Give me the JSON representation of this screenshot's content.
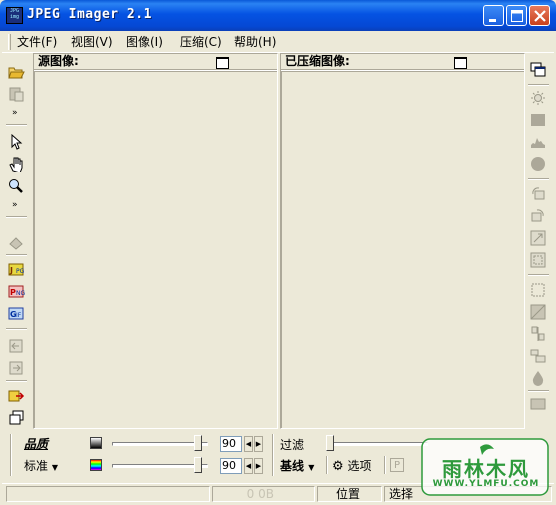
{
  "window": {
    "title": "JPEG Imager 2.1",
    "icon_text": "JPG img"
  },
  "menu": [
    {
      "label": "文件(F)"
    },
    {
      "label": "视图(V)"
    },
    {
      "label": "图像(I)"
    },
    {
      "label": "压缩(C)"
    },
    {
      "label": "帮助(H)"
    }
  ],
  "panels": {
    "source": {
      "title": "源图像:"
    },
    "compressed": {
      "title": "已压缩图像:"
    }
  },
  "controls": {
    "quality_label": "品质",
    "standard_label": "标准",
    "quality_value": "90",
    "chroma_value": "90",
    "filter_label": "过滤",
    "baseline_label": "基线",
    "options_label": "选项",
    "quality_slider_level": 0.9,
    "chroma_slider_level": 0.9
  },
  "status": {
    "size": "0 0B",
    "position": "位置",
    "selection": "选择"
  },
  "watermark": {
    "text": "雨林木风",
    "url": "WWW.YLMFU.COM"
  },
  "colors": {
    "titlebar": "#0553e3",
    "face": "#ece9d8",
    "watermark_green": "#2e9a3c"
  },
  "icons": {
    "left": [
      "open-folder-icon",
      "paste-icon",
      "pointer-icon",
      "hand-icon",
      "zoom-icon",
      "apply-icon",
      "jpeg-format-icon",
      "png-format-icon",
      "gif-format-icon",
      "back-icon",
      "forward-icon",
      "export-icon",
      "windows-icon"
    ],
    "right": [
      "window-list-icon",
      "brightness-icon",
      "contrast-icon",
      "histogram-icon",
      "circle-icon",
      "rotate-left-icon",
      "rotate-right-icon",
      "resize-icon",
      "crop-icon",
      "select-icon",
      "grayscale-icon",
      "split-icon",
      "align-icon",
      "drop-icon",
      "fill-icon"
    ]
  }
}
